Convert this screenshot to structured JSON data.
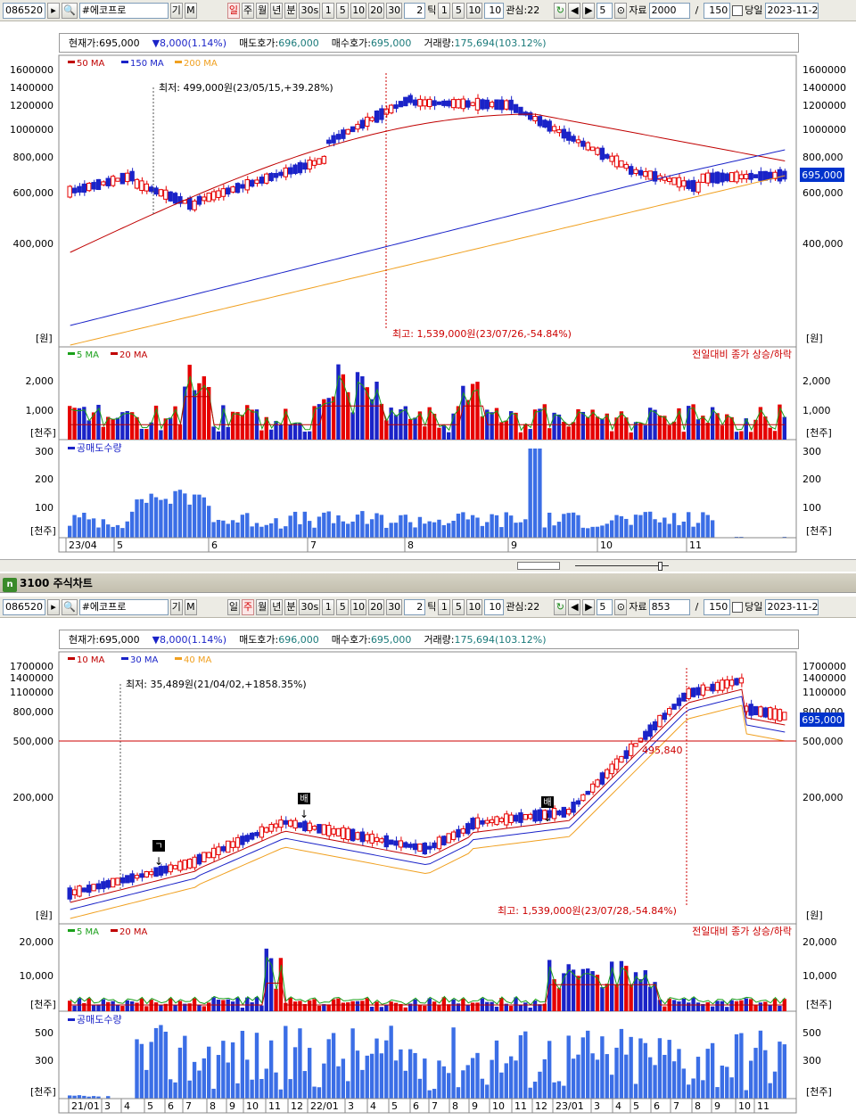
{
  "top_toolbar": {
    "code": "086520",
    "name": "#에코프로",
    "gi": "기",
    "m": "M",
    "periods": [
      "일",
      "주",
      "월",
      "년",
      "분",
      "30s"
    ],
    "nums": [
      "1",
      "5",
      "10",
      "20",
      "30"
    ],
    "tick_val": "2",
    "tick_label": "틱",
    "tick_nums": [
      "1",
      "5",
      "10"
    ],
    "ten": "10",
    "interest": "관심:22",
    "step": "5",
    "data_label": "자료",
    "data_count": "2000",
    "slash": "/",
    "page_size": "150",
    "today": "당일",
    "date": "2023-11-2"
  },
  "bottom_toolbar": {
    "code": "086520",
    "name": "#에코프로",
    "gi": "기",
    "m": "M",
    "periods": [
      "일",
      "주",
      "월",
      "년",
      "분",
      "30s"
    ],
    "nums": [
      "1",
      "5",
      "10",
      "20",
      "30"
    ],
    "tick_val": "2",
    "tick_label": "틱",
    "tick_nums": [
      "1",
      "5",
      "10"
    ],
    "ten": "10",
    "interest": "관심:22",
    "step": "5",
    "data_label": "자료",
    "data_count": "853",
    "slash": "/",
    "page_size": "150",
    "today": "당일",
    "date": "2023-11-2"
  },
  "info": {
    "cur_label": "현재가:",
    "cur": "695,000",
    "chg": "▼8,000(1.14%)",
    "ask_label": "매도호가:",
    "ask": "696,000",
    "bid_label": "매수호가:",
    "bid": "695,000",
    "vol_label": "거래량:",
    "vol": "175,694(103.12%)"
  },
  "window_title": "3100 주식차트",
  "unit_won": "[원]",
  "unit_thousand": "[천주]",
  "colors": {
    "up": "#e60000",
    "down": "#1a23c8",
    "ma_red": "#c00000",
    "ma_blue": "#1a23c8",
    "ma_orange": "#f0a020",
    "ma_green": "#1aa01a"
  },
  "chart_data": [
    {
      "type": "candlestick",
      "period": "daily",
      "ma_legend": [
        "50 MA",
        "150 MA",
        "200 MA"
      ],
      "y_ticks": [
        "1600000",
        "1400000",
        "1200000",
        "1000000",
        "800,000",
        "600,000",
        "400,000"
      ],
      "y_ticks_right": [
        "1600000",
        "1400000",
        "1200000",
        "1000000",
        "800,000",
        "600,000",
        "400,000"
      ],
      "current_price": "695,000",
      "low_annot": "최저: 499,000원(23/05/15,+39.28%)",
      "high_annot": "최고: 1,539,000원(23/07/26,-54.84%)",
      "x_labels": [
        "23/04",
        "5",
        "6",
        "7",
        "8",
        "9",
        "10",
        "11"
      ],
      "volume": {
        "legend": [
          "5 MA",
          "20 MA"
        ],
        "note": "전일대비 종가 상승/하락",
        "y_ticks": [
          "2,000",
          "1,000"
        ]
      },
      "short_sell": {
        "legend": "공매도수량",
        "y_ticks": [
          "300",
          "200",
          "100"
        ]
      }
    },
    {
      "type": "candlestick",
      "period": "weekly",
      "ma_legend": [
        "10 MA",
        "30 MA",
        "40 MA"
      ],
      "y_ticks": [
        "1700000",
        "1400000",
        "1100000",
        "800,000",
        "500,000",
        "200,000"
      ],
      "y_ticks_right": [
        "1700000",
        "1400000",
        "1100000",
        "800,000",
        "500,000",
        "200,000"
      ],
      "current_price": "695,000",
      "hline_label": "495,840",
      "low_annot": "최저: 35,489원(21/04/02,+1858.35%)",
      "high_annot": "최고: 1,539,000원(23/07/28,-54.84%)",
      "markers": [
        "ㄱ",
        "배",
        "배"
      ],
      "x_labels": [
        "21/01",
        "3",
        "4",
        "5",
        "6",
        "7",
        "8",
        "9",
        "10",
        "11",
        "12",
        "22/01",
        "3",
        "4",
        "5",
        "6",
        "7",
        "8",
        "9",
        "10",
        "11",
        "12",
        "23/01",
        "3",
        "4",
        "5",
        "6",
        "7",
        "8",
        "9",
        "10",
        "11"
      ],
      "volume": {
        "legend": [
          "5 MA",
          "20 MA"
        ],
        "note": "전일대비 종가 상승/하락",
        "y_ticks": [
          "20,000",
          "10,000"
        ]
      },
      "short_sell": {
        "legend": "공매도수량",
        "y_ticks": [
          "500",
          "300"
        ]
      }
    }
  ]
}
